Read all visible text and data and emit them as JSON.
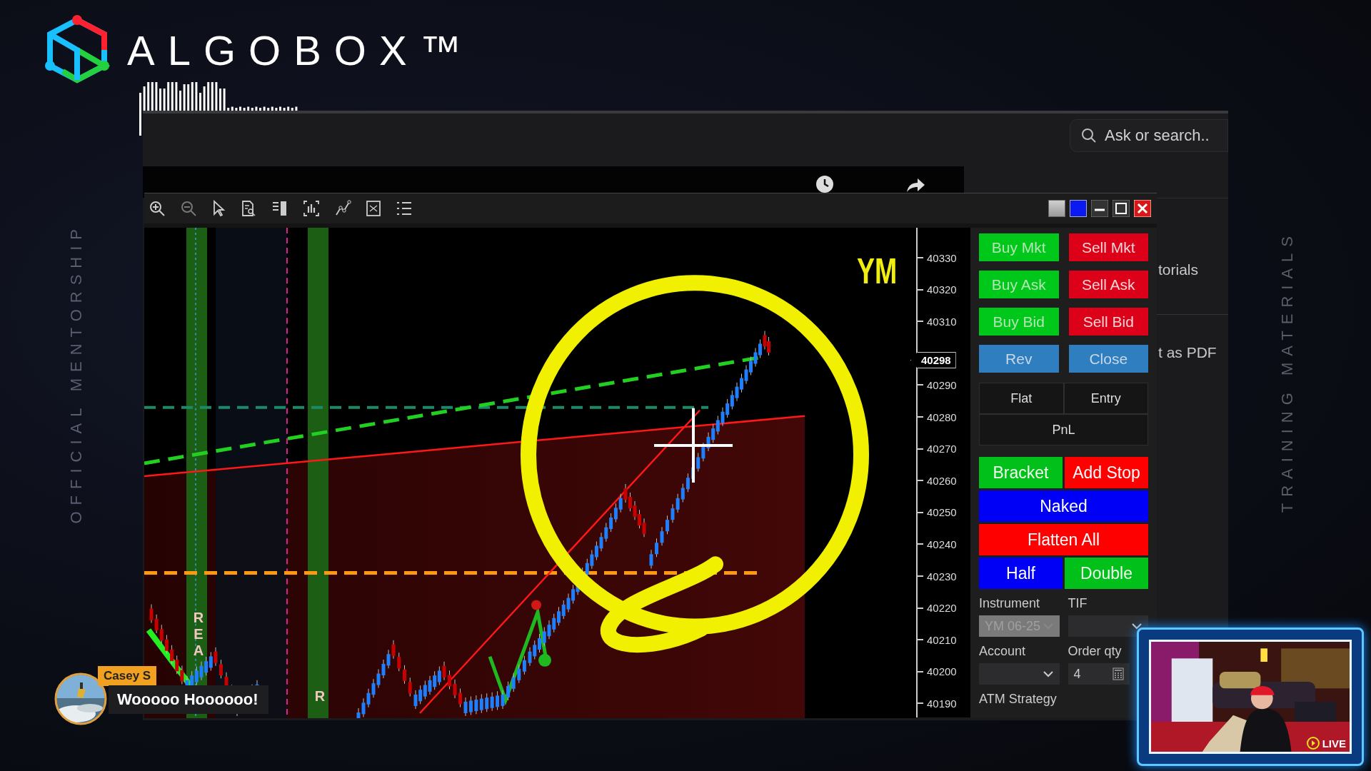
{
  "brand": {
    "name": "ALGOBOX™"
  },
  "side_captions": [
    "OFFICIAL MENTORSHIP",
    "TRAINING MATERIALS"
  ],
  "search": {
    "placeholder": "Ask or search.."
  },
  "background_page": {
    "texts": [
      "torials",
      "t as PDF"
    ]
  },
  "chart": {
    "symbol": "YM",
    "current_price": "40298",
    "price_axis_above": [
      "40330",
      "40320",
      "40310"
    ],
    "price_axis_below": [
      "40290",
      "40280",
      "40270",
      "40260",
      "40250",
      "40240",
      "40230",
      "40220",
      "40210",
      "40200",
      "40190"
    ],
    "band_labels": [
      "REA",
      "R"
    ]
  },
  "order_buttons": [
    {
      "label": "Buy Mkt",
      "kind": "buy"
    },
    {
      "label": "Sell Mkt",
      "kind": "sell"
    },
    {
      "label": "Buy Ask",
      "kind": "buy"
    },
    {
      "label": "Sell Ask",
      "kind": "sell"
    },
    {
      "label": "Buy Bid",
      "kind": "buy"
    },
    {
      "label": "Sell Bid",
      "kind": "sell"
    },
    {
      "label": "Rev",
      "kind": "neutral"
    },
    {
      "label": "Close",
      "kind": "neutral"
    }
  ],
  "position_info": [
    "Flat",
    "Entry",
    "PnL"
  ],
  "strategy_buttons": [
    {
      "label": "Bracket",
      "kind": "green",
      "wide": false
    },
    {
      "label": "Add Stop",
      "kind": "red",
      "wide": false
    },
    {
      "label": "Naked",
      "kind": "blue",
      "wide": true
    },
    {
      "label": "Flatten All",
      "kind": "red",
      "wide": true
    },
    {
      "label": "Half",
      "kind": "blue",
      "wide": false
    },
    {
      "label": "Double",
      "kind": "green",
      "wide": false
    }
  ],
  "fields": [
    {
      "label": "Instrument",
      "kind": "select",
      "value": "YM 06-25",
      "disabled": true
    },
    {
      "label": "TIF",
      "kind": "select",
      "disabled": false
    },
    {
      "label": "Account",
      "kind": "select",
      "disabled": false
    },
    {
      "label": "Order qty",
      "kind": "number",
      "value": "4",
      "disabled": false
    }
  ],
  "atm_label": "ATM Strategy",
  "chat": {
    "user": "Casey S",
    "message": "Wooooo Hoooooo!"
  },
  "webcam": {
    "badge": "LIVE"
  }
}
